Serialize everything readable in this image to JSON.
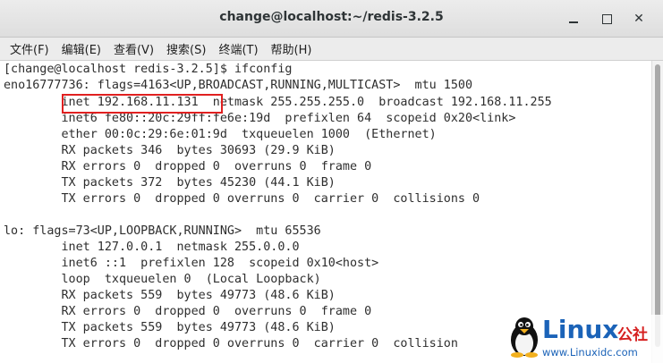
{
  "window": {
    "title": "change@localhost:~/redis-3.2.5"
  },
  "menubar": {
    "items": [
      "文件(F)",
      "编辑(E)",
      "查看(V)",
      "搜索(S)",
      "终端(T)",
      "帮助(H)"
    ]
  },
  "terminal": {
    "lines": [
      "[change@localhost redis-3.2.5]$ ifconfig",
      "eno16777736: flags=4163<UP,BROADCAST,RUNNING,MULTICAST>  mtu 1500",
      "        inet 192.168.11.131  netmask 255.255.255.0  broadcast 192.168.11.255",
      "        inet6 fe80::20c:29ff:fe6e:19d  prefixlen 64  scopeid 0x20<link>",
      "        ether 00:0c:29:6e:01:9d  txqueuelen 1000  (Ethernet)",
      "        RX packets 346  bytes 30693 (29.9 KiB)",
      "        RX errors 0  dropped 0  overruns 0  frame 0",
      "        TX packets 372  bytes 45230 (44.1 KiB)",
      "        TX errors 0  dropped 0 overruns 0  carrier 0  collisions 0",
      "",
      "lo: flags=73<UP,LOOPBACK,RUNNING>  mtu 65536",
      "        inet 127.0.0.1  netmask 255.0.0.0",
      "        inet6 ::1  prefixlen 128  scopeid 0x10<host>",
      "        loop  txqueuelen 0  (Local Loopback)",
      "        RX packets 559  bytes 49773 (48.6 KiB)",
      "        RX errors 0  dropped 0  overruns 0  frame 0",
      "        TX packets 559  bytes 49773 (48.6 KiB)",
      "        TX errors 0  dropped 0 overruns 0  carrier 0  collision"
    ],
    "highlighted_text": "inet 192.168.11.131",
    "highlight_color": "#e02020"
  },
  "watermark": {
    "brand": "Linux",
    "suffix": "公社",
    "url": "www.Linuxidc.com"
  },
  "icons": {
    "minimize": "minimize-icon",
    "maximize": "maximize-icon",
    "close": "close-icon",
    "logo": "tux-penguin-icon"
  },
  "colors": {
    "titlebar": "#dedede",
    "terminal_bg": "#ffffff",
    "terminal_text": "#2e2e2e",
    "brand_blue": "#1b63b8",
    "brand_red": "#d62020"
  }
}
